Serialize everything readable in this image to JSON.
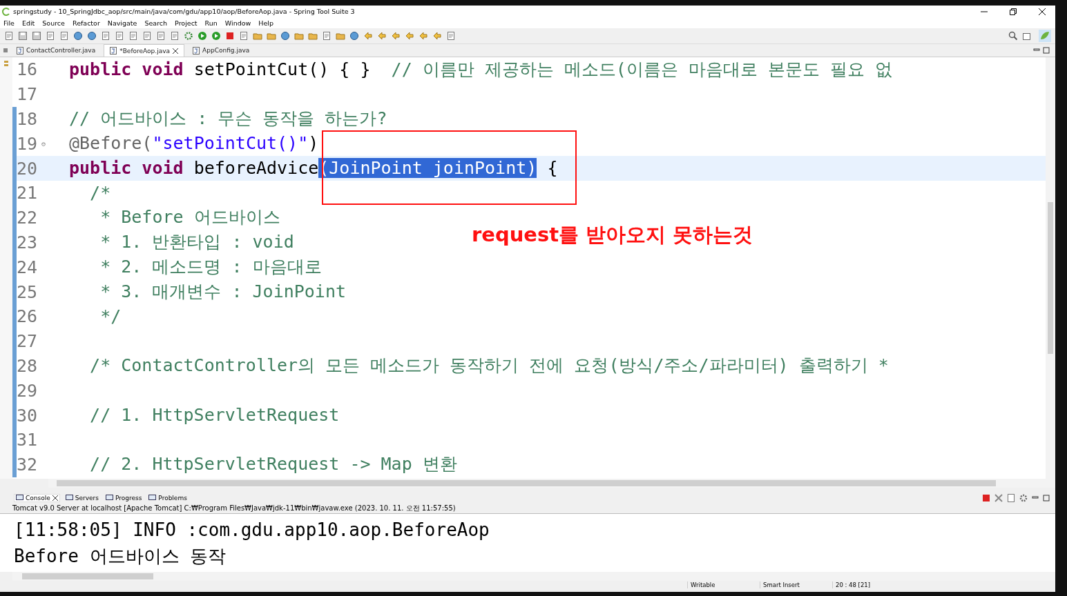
{
  "window": {
    "title": "springstudy - 10_SpringJdbc_aop/src/main/java/com/gdu/app10/aop/BeforeAop.java - Spring Tool Suite 3"
  },
  "menu": [
    "File",
    "Edit",
    "Source",
    "Refactor",
    "Navigate",
    "Search",
    "Project",
    "Run",
    "Window",
    "Help"
  ],
  "editor_tabs": [
    {
      "label": "ContactController.java",
      "selected": false,
      "closable": false
    },
    {
      "label": "*BeforeAop.java",
      "selected": true,
      "closable": true
    },
    {
      "label": "AppConfig.java",
      "selected": false,
      "closable": false
    }
  ],
  "code_lines": [
    {
      "number": "16",
      "changed": false,
      "current": false,
      "tokens": [
        {
          "kind": "keyword",
          "text": "public void "
        },
        {
          "kind": "plain",
          "text": "setPointCut() { }  "
        },
        {
          "kind": "comment",
          "text": "// 이름만 제공하는 메소드(이름은 마음대로 본문도 필요 없"
        }
      ]
    },
    {
      "number": "17",
      "changed": false,
      "current": false
    },
    {
      "number": "18",
      "changed": true,
      "current": false,
      "tokens": [
        {
          "kind": "comment",
          "text": "// 어드바이스 : 무슨 동작을 하는가?"
        }
      ]
    },
    {
      "number": "19",
      "changed": true,
      "current": false,
      "fold": "⊖",
      "tokens": [
        {
          "kind": "annotation",
          "text": "@Before("
        },
        {
          "kind": "string",
          "text": "\"setPointCut()\""
        },
        {
          "kind": "plain",
          "text": ")"
        }
      ]
    },
    {
      "number": "20",
      "changed": true,
      "current": true,
      "tokens": [
        {
          "kind": "keyword",
          "text": "public void "
        },
        {
          "kind": "plain",
          "text": "beforeAdvice"
        },
        {
          "kind": "selection",
          "text": "(JoinPoint joinPoint)"
        },
        {
          "kind": "plain",
          "text": " {"
        }
      ]
    },
    {
      "number": "21",
      "changed": true,
      "current": false,
      "tokens": [
        {
          "kind": "comment",
          "text": "  /*"
        }
      ]
    },
    {
      "number": "22",
      "changed": true,
      "current": false,
      "tokens": [
        {
          "kind": "comment",
          "text": "   * Before 어드바이스"
        }
      ]
    },
    {
      "number": "23",
      "changed": true,
      "current": false,
      "tokens": [
        {
          "kind": "comment",
          "text": "   * 1. 반환타입 : void"
        }
      ]
    },
    {
      "number": "24",
      "changed": true,
      "current": false,
      "tokens": [
        {
          "kind": "comment",
          "text": "   * 2. 메소드명 : 마음대로"
        }
      ]
    },
    {
      "number": "25",
      "changed": true,
      "current": false,
      "tokens": [
        {
          "kind": "comment",
          "text": "   * 3. 매개변수 : JoinPoint"
        }
      ]
    },
    {
      "number": "26",
      "changed": true,
      "current": false,
      "tokens": [
        {
          "kind": "comment",
          "text": "   */"
        }
      ]
    },
    {
      "number": "27",
      "changed": true,
      "current": false
    },
    {
      "number": "28",
      "changed": true,
      "current": false,
      "tokens": [
        {
          "kind": "comment",
          "text": "  /* ContactController의 모든 메소드가 동작하기 전에 요청(방식/주소/파라미터) 출력하기 *"
        }
      ]
    },
    {
      "number": "29",
      "changed": true,
      "current": false
    },
    {
      "number": "30",
      "changed": true,
      "current": false,
      "tokens": [
        {
          "kind": "comment",
          "text": "  // 1. HttpServletRequest"
        }
      ]
    },
    {
      "number": "31",
      "changed": true,
      "current": false
    },
    {
      "number": "32",
      "changed": true,
      "current": false,
      "tokens": [
        {
          "kind": "comment",
          "text": "  // 2. HttpServletRequest -> Map 변환"
        }
      ]
    }
  ],
  "annotation": {
    "text": "request를 받아오지 못하는것"
  },
  "console_tabs": [
    {
      "label": "Console",
      "selected": true
    },
    {
      "label": "Servers",
      "selected": false
    },
    {
      "label": "Progress",
      "selected": false
    },
    {
      "label": "Problems",
      "selected": false
    }
  ],
  "console_description": "Tomcat v9.0 Server at localhost [Apache Tomcat] C:₩Program Files₩Java₩jdk-11₩bin₩javaw.exe  (2023. 10. 11. 오전 11:57:55)",
  "console_lines": [
    "[11:58:05] INFO :com.gdu.app10.aop.BeforeAop",
    "Before 어드바이스 동작"
  ],
  "status_bar": [
    "Writable",
    "Smart Insert",
    "20 : 48 [21]"
  ]
}
